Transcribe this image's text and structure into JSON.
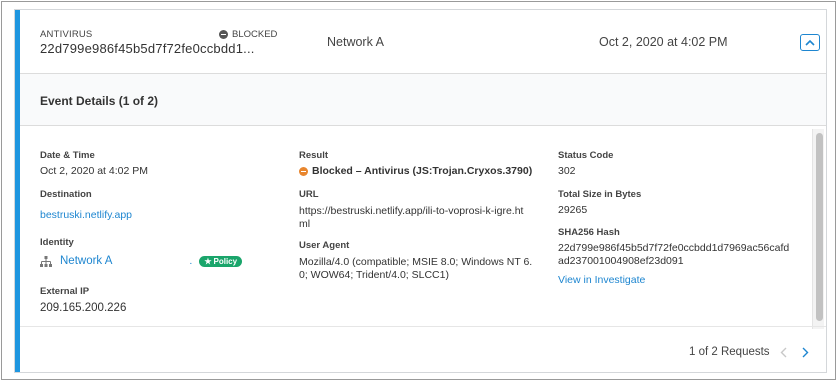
{
  "header": {
    "type_label": "ANTIVIRUS",
    "status_label": "BLOCKED",
    "hash_truncated": "22d799e986f45b5d7f72fe0ccbdd1...",
    "network": "Network A",
    "date": "Oct 2, 2020 at 4:02 PM"
  },
  "event": {
    "title": "Event Details (1 of 2)"
  },
  "details": {
    "date_time": {
      "label": "Date & Time",
      "value": "Oct 2, 2020 at 4:02 PM"
    },
    "destination": {
      "label": "Destination",
      "value": "bestruski.netlify.app"
    },
    "identity": {
      "label": "Identity",
      "value": "Network A",
      "dot": ".",
      "badge": "Policy"
    },
    "external_ip": {
      "label": "External IP",
      "value": "209.165.200.226"
    },
    "result": {
      "label": "Result",
      "value": "Blocked – Antivirus (JS:Trojan.Cryxos.3790)"
    },
    "url": {
      "label": "URL",
      "line1": "https://bestruski.netlify.app/ili-to-voprosi-k-igre.ht",
      "line2": "ml"
    },
    "user_agent": {
      "label": "User Agent",
      "line1": "Mozilla/4.0 (compatible; MSIE 8.0; Windows NT 6.",
      "line2": "0; WOW64; Trident/4.0; SLCC1)"
    },
    "status_code": {
      "label": "Status Code",
      "value": "302"
    },
    "total_size": {
      "label": "Total Size in Bytes",
      "value": "29265"
    },
    "sha256": {
      "label": "SHA256 Hash",
      "line1": "22d799e986f45b5d7f72fe0ccbdd1d7969ac56cafd",
      "line2": "ad237001004908ef23d091"
    },
    "investigate_link": "View in Investigate"
  },
  "footer": {
    "pager": "1 of 2 Requests"
  },
  "colors": {
    "accent": "#1e96e0",
    "link": "#1e86d0",
    "blocked_result": "#e8862e",
    "policy_badge": "#1aa56b"
  },
  "icons": [
    "minus-circle-icon",
    "chevron-up-icon",
    "network-tree-icon",
    "star-icon",
    "chevron-left-icon",
    "chevron-right-icon"
  ]
}
